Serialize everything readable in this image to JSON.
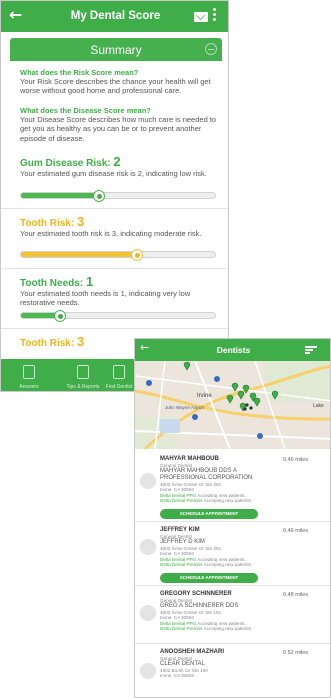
{
  "score_screen": {
    "title": "My Dental Score",
    "back_icon": "back-arrow-icon",
    "mail_icon": "mail-icon",
    "menu_icon": "more-vertical-icon",
    "summary_label": "Summary",
    "risk_question": "What does the Risk Score mean?",
    "risk_answer": "Your Risk Score describes the chance your health will get worse without good home and professional care.",
    "disease_question": "What does the Disease Score mean?",
    "disease_answer": "Your Disease Score describes how much care is needed to get you as healthy as you can be or to prevent another episode of disease.",
    "scores": [
      {
        "label": "Gum Disease Risk: ",
        "value": "2",
        "level": 0.4,
        "color": "green",
        "description": "Your estimated gum disease risk is 2, indicating low risk."
      },
      {
        "label": "Tooth Risk: ",
        "value": "3",
        "level": 0.6,
        "color": "yellow",
        "description": "Your estimated tooth risk is 3, indicating moderate risk."
      },
      {
        "label": "Tooth Needs: ",
        "value": "1",
        "level": 0.2,
        "color": "green",
        "description": "Your estimated tooth needs is 1, indicating very low restorative needs."
      },
      {
        "label": "Tooth Risk: ",
        "value": "3",
        "level": 0.6,
        "color": "yellow",
        "description": ""
      }
    ],
    "nav": [
      {
        "label": "Answers",
        "icon": "answers-icon"
      },
      {
        "label": "Tips & Reports",
        "icon": "tips-icon"
      },
      {
        "label": "Find Dentist",
        "icon": "find-dentist-icon"
      }
    ],
    "colors": {
      "primary": "#3fae49",
      "yellow": "#f0b41d"
    }
  },
  "dentists_screen": {
    "title": "Dentists",
    "back_icon": "back-arrow-icon",
    "filter_icon": "filter-icon",
    "map_labels": [
      "Irvine",
      "John Wayne Airport",
      "Lake"
    ],
    "dentists": [
      {
        "name": "MAHYAR MAHBOUB",
        "miles": "0.46 miles",
        "title": "General Dentist",
        "practice": "MAHYAR MAHBOUB DDS A PROFESSIONAL CORPORATION",
        "addr1": "4902 Irvine Center Dr Ste 202",
        "addr2": "Irvine, CA 92604",
        "plan1": "Delta Dental PPO",
        "plan2": "Delta Dental Premier",
        "note": "Accepting new patients",
        "button": "SCHEDULE APPOINTMENT"
      },
      {
        "name": "JEFFREY KIM",
        "miles": "0.46 miles",
        "title": "General Dentist",
        "practice": "JEFFREY D KIM",
        "addr1": "4902 Irvine Center Dr Ste 201",
        "addr2": "Irvine, CA 92604",
        "plan1": "Delta Dental PPO",
        "plan2": "Delta Dental Premier",
        "note": "Accepting new patients",
        "button": "SCHEDULE APPOINTMENT"
      },
      {
        "name": "GREGORY SCHINNERER",
        "miles": "0.48 miles",
        "title": "General Dentist",
        "practice": "GREG A SCHINNERER DDS",
        "addr1": "4902 Irvine Center Dr Ste 101",
        "addr2": "Irvine, CA 92604",
        "plan1": "Delta Dental PPO",
        "plan2": "Delta Dental Premier",
        "note": "Accepting new patients"
      },
      {
        "name": "ANOOSHEH MAZHARI",
        "miles": "0.52 miles",
        "title": "General Dentist",
        "practice": "CLEAR DENTAL",
        "addr1": "4902 Booth Cir Ste 100",
        "addr2": "Irvine, CA 92604"
      }
    ]
  }
}
